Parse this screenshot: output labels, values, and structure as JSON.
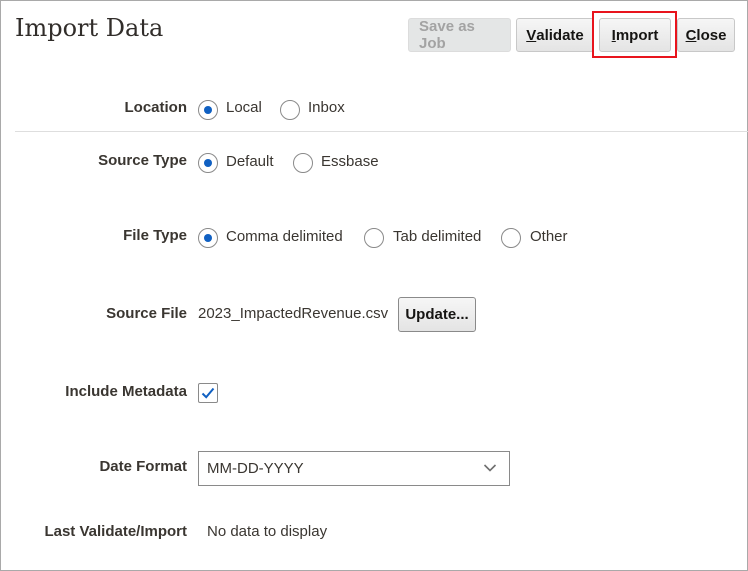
{
  "dialog": {
    "title": "Import Data"
  },
  "toolbar": {
    "save_as_job": "Save as Job",
    "validate_u": "V",
    "validate_rest": "alidate",
    "import_u": "I",
    "import_rest": "mport",
    "close_u": "C",
    "close_rest": "lose"
  },
  "location": {
    "label": "Location",
    "options": [
      "Local",
      "Inbox"
    ],
    "selected": "Local"
  },
  "source_type": {
    "label": "Source Type",
    "options": [
      "Default",
      "Essbase"
    ],
    "selected": "Default"
  },
  "file_type": {
    "label": "File Type",
    "options": [
      "Comma delimited",
      "Tab delimited",
      "Other"
    ],
    "selected": "Comma delimited"
  },
  "source_file": {
    "label": "Source File",
    "value": "2023_ImpactedRevenue.csv",
    "update_label": "Update..."
  },
  "include_metadata": {
    "label": "Include Metadata",
    "checked": true
  },
  "date_format": {
    "label": "Date Format",
    "value": "MM-DD-YYYY"
  },
  "last_validate": {
    "label": "Last Validate/Import",
    "value": "No data to display"
  },
  "colors": {
    "accent": "#1060c2",
    "highlight": "#e8141d"
  }
}
